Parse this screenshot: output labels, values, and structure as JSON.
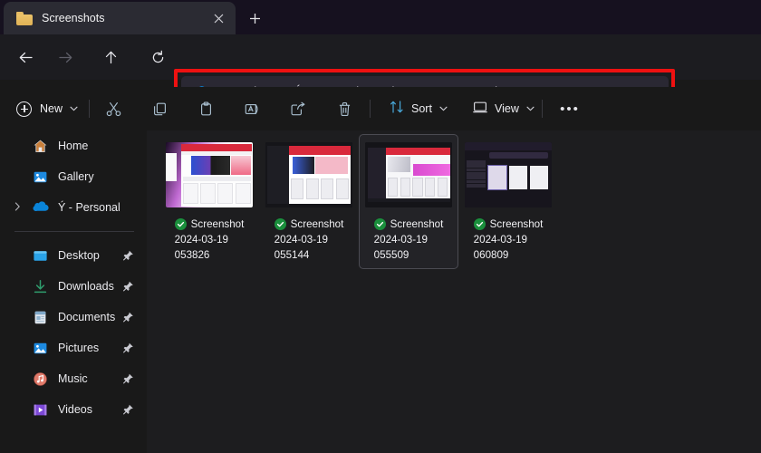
{
  "window": {
    "tab": {
      "title": "Screenshots",
      "folder_icon": "folder-icon",
      "close_icon": "close-icon"
    },
    "new_tab_label": "+"
  },
  "nav": {
    "back": "back-arrow-icon",
    "forward": "forward-arrow-icon",
    "up": "up-arrow-icon",
    "refresh": "refresh-icon"
  },
  "address": {
    "cloud_icon": "onedrive-cloud-icon",
    "separator": "›",
    "crumbs": [
      {
        "label": "OneDrive"
      },
      {
        "label": "Ý - Personal"
      },
      {
        "label": "Pictures"
      },
      {
        "label": "Screenshots"
      }
    ]
  },
  "annotation": {
    "color": "#ee1111",
    "shape": "rectangle",
    "target": "address-bar"
  },
  "toolbar": {
    "new_label": "New",
    "chevron": "⌄",
    "cut_label": "Cut",
    "copy_label": "Copy",
    "paste_label": "Paste",
    "rename_label": "Rename",
    "share_label": "Share",
    "delete_label": "Delete",
    "sort_label": "Sort",
    "view_label": "View",
    "more_label": "•••"
  },
  "sidebar": {
    "items": [
      {
        "label": "Home",
        "icon": "home-icon",
        "pinned": false,
        "expandable": false
      },
      {
        "label": "Gallery",
        "icon": "gallery-icon",
        "pinned": false,
        "expandable": false
      },
      {
        "label": "Ý - Personal",
        "icon": "onedrive-cloud-icon",
        "pinned": false,
        "expandable": true
      },
      {
        "label": "Desktop",
        "icon": "desktop-icon",
        "pinned": true,
        "expandable": false
      },
      {
        "label": "Downloads",
        "icon": "downloads-icon",
        "pinned": true,
        "expandable": false
      },
      {
        "label": "Documents",
        "icon": "documents-icon",
        "pinned": true,
        "expandable": false
      },
      {
        "label": "Pictures",
        "icon": "pictures-icon",
        "pinned": true,
        "expandable": false
      },
      {
        "label": "Music",
        "icon": "music-icon",
        "pinned": true,
        "expandable": false
      },
      {
        "label": "Videos",
        "icon": "videos-icon",
        "pinned": true,
        "expandable": false
      }
    ]
  },
  "files": [
    {
      "name_lines": [
        "Screenshot",
        "2024-03-19",
        "053826"
      ],
      "sync_status": "synced",
      "selected": false,
      "thumb": "shot-a"
    },
    {
      "name_lines": [
        "Screenshot",
        "2024-03-19",
        "055144"
      ],
      "sync_status": "synced",
      "selected": false,
      "thumb": "shot-b"
    },
    {
      "name_lines": [
        "Screenshot",
        "2024-03-19",
        "055509"
      ],
      "sync_status": "synced",
      "selected": true,
      "thumb": "shot-c"
    },
    {
      "name_lines": [
        "Screenshot",
        "2024-03-19",
        "060809"
      ],
      "sync_status": "synced",
      "selected": false,
      "thumb": "shot-d"
    }
  ],
  "colors": {
    "titlebar_bg": "#16111f",
    "navrow_bg": "#1c1c20",
    "addressbar_bg": "#2a2833",
    "content_bg": "#1d1d1f",
    "sidebar_bg": "#191919",
    "accent_blue": "#0a84d8",
    "sync_green": "#1a8f3c",
    "annotation_red": "#ee1111"
  }
}
